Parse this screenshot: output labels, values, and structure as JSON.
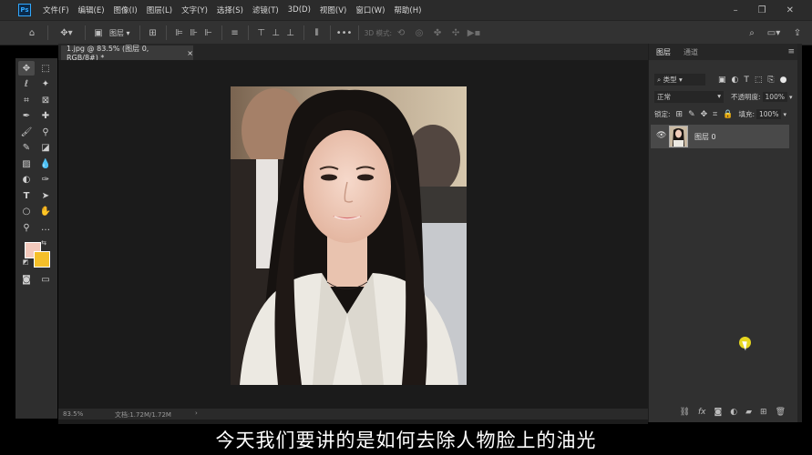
{
  "app": {
    "logo_text": "Ps"
  },
  "menu": [
    "文件(F)",
    "编辑(E)",
    "图像(I)",
    "图层(L)",
    "文字(Y)",
    "选择(S)",
    "滤镜(T)",
    "3D(D)",
    "视图(V)",
    "窗口(W)",
    "帮助(H)"
  ],
  "window_controls": {
    "minimize": "–",
    "restore": "❐",
    "close": "✕"
  },
  "options_bar": {
    "layer_select": "图层",
    "mode_3d": "3D 模式:"
  },
  "document": {
    "tab_title": "1.jpg @ 83.5% (图层 0, RGB/8#) *",
    "close": "×"
  },
  "status_bar": {
    "zoom": "83.5%",
    "doc_info": "文档:1.72M/1.72M",
    "arrow": "›"
  },
  "layers_panel": {
    "tabs": [
      "图层",
      "通道"
    ],
    "filter_kind": "类型",
    "blend_mode": "正常",
    "opacity_label": "不透明度:",
    "opacity_value": "100%",
    "lock_label": "锁定:",
    "fill_label": "填充:",
    "fill_value": "100%",
    "layers": [
      {
        "name": "图层 0",
        "visible": true
      }
    ]
  },
  "colors": {
    "foreground": "#f3c9bc",
    "background": "#f5bf29",
    "cursor": "#f1df1f"
  },
  "subtitle": "今天我们要讲的是如何去除人物脸上的油光"
}
